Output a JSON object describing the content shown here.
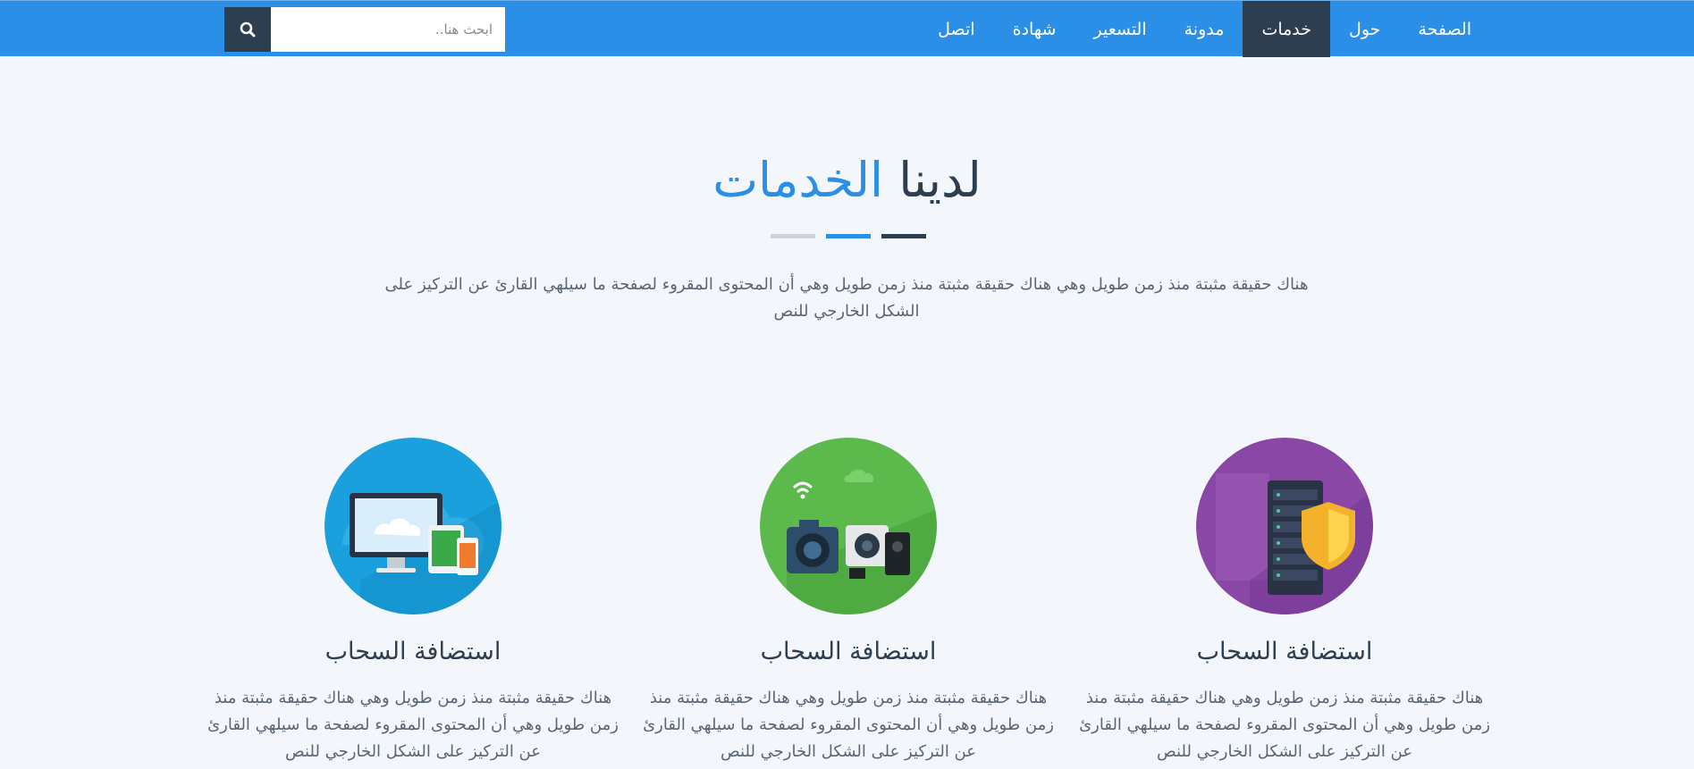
{
  "nav": {
    "items": [
      {
        "label": "الصفحة",
        "active": false
      },
      {
        "label": "حول",
        "active": false
      },
      {
        "label": "خدمات",
        "active": true
      },
      {
        "label": "مدونة",
        "active": false
      },
      {
        "label": "التسعير",
        "active": false
      },
      {
        "label": "شهادة",
        "active": false
      },
      {
        "label": "اتصل",
        "active": false
      }
    ]
  },
  "search": {
    "placeholder": "ابحث هنا..",
    "icon": "search-icon"
  },
  "section": {
    "title_main": "لدينا",
    "title_highlight": "الخدمات",
    "description": "هناك حقيقة مثبتة منذ زمن طويل وهي هناك حقيقة مثبتة منذ زمن طويل وهي أن المحتوى المقروء لصفحة ما سيلهي القارئ عن التركيز على الشكل الخارجي للنص"
  },
  "colors": {
    "primary": "#2b8fe8",
    "dark": "#2c3e50",
    "background": "#f3f7fb"
  },
  "cards": [
    {
      "icon": "server-shield-icon",
      "title": "استضافة السحاب",
      "text": "هناك حقيقة مثبتة منذ زمن طويل وهي هناك حقيقة مثبتة منذ زمن طويل وهي أن المحتوى المقروء لصفحة ما سيلهي القارئ عن التركيز على الشكل الخارجي للنص"
    },
    {
      "icon": "camera-devices-icon",
      "title": "استضافة السحاب",
      "text": "هناك حقيقة مثبتة منذ زمن طويل وهي هناك حقيقة مثبتة منذ زمن طويل وهي أن المحتوى المقروء لصفحة ما سيلهي القارئ عن التركيز على الشكل الخارجي للنص"
    },
    {
      "icon": "cloud-devices-icon",
      "title": "استضافة السحاب",
      "text": "هناك حقيقة مثبتة منذ زمن طويل وهي هناك حقيقة مثبتة منذ زمن طويل وهي أن المحتوى المقروء لصفحة ما سيلهي القارئ عن التركيز على الشكل الخارجي للنص"
    }
  ]
}
